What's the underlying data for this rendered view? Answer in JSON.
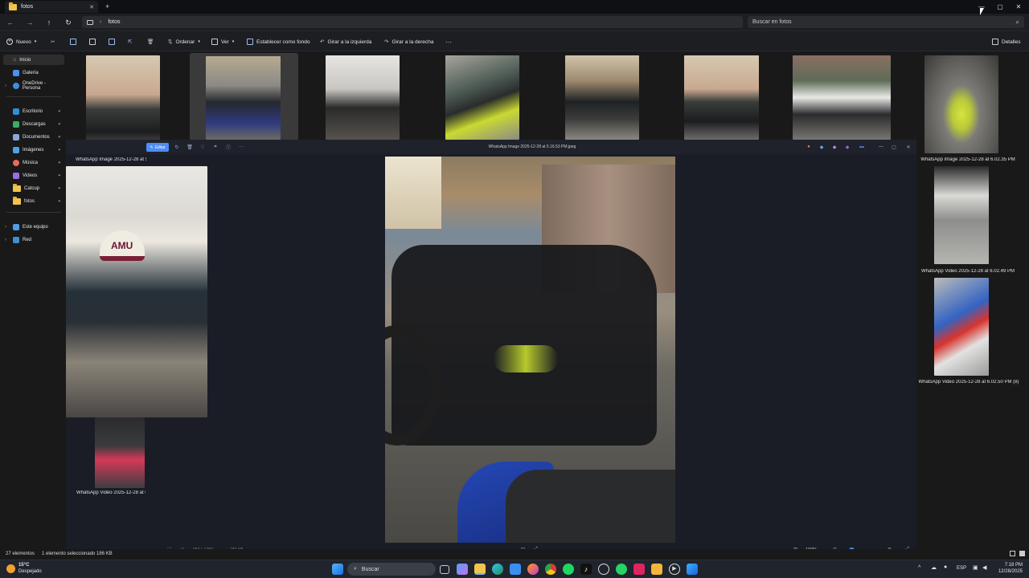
{
  "window": {
    "tab_title": "fotos",
    "tab_close": "✕",
    "new_tab": "+",
    "controls": {
      "minimize": "—",
      "maximize": "▢",
      "close": "✕"
    }
  },
  "address": {
    "path": "fotos",
    "search_placeholder": "Buscar en fotos"
  },
  "toolbar": {
    "new_label": "Nuevo",
    "sort_label": "Ordenar",
    "view_label": "Ver",
    "set_background_label": "Establecer como fondo",
    "rotate_left_label": "Girar a la izquierda",
    "rotate_right_label": "Girar a la derecha",
    "more_label": "···",
    "details_label": "Detalles"
  },
  "sidebar": {
    "items": [
      {
        "label": "Inicio"
      },
      {
        "label": "Galería"
      },
      {
        "label": "OneDrive - Persona"
      },
      {
        "label": "Escritorio"
      },
      {
        "label": "Descargas"
      },
      {
        "label": "Documentos"
      },
      {
        "label": "Imágenes"
      },
      {
        "label": "Música"
      },
      {
        "label": "Videos"
      },
      {
        "label": "Catcup"
      },
      {
        "label": "fotos"
      },
      {
        "label": "Este equipo"
      },
      {
        "label": "Red"
      }
    ]
  },
  "files": {
    "captions": [
      "WhatsApp Image 2025-12-28 at 5",
      "WhatsApp Image 2025-12-28 at 6.02.35 PM",
      "WhatsApp Video 2025-12-28 at 6.02.49 PM",
      "WhatsApp Video 2025-12-28 at 6.02.50 PM (8)",
      "WhatsApp Video 2025-12-28 at 6"
    ]
  },
  "viewer": {
    "edit_label": "Editar",
    "filename": "WhatsApp Image 2025-12-28 at 5.16.53 PM.jpeg",
    "dims": "960 x 1280",
    "size": "186 KB",
    "zoom": "100%"
  },
  "status": {
    "count": "27 elementos",
    "selected": "1 elemento seleccionado  186 KB"
  },
  "taskbar": {
    "weather_temp": "15°C",
    "weather_desc": "Despejado",
    "search_label": "Buscar",
    "lang": "ESP",
    "time": "7:18 PM",
    "date": "12/28/2025"
  },
  "colors": {
    "accent": "#4c8df6",
    "folder": "#f0c44d"
  }
}
